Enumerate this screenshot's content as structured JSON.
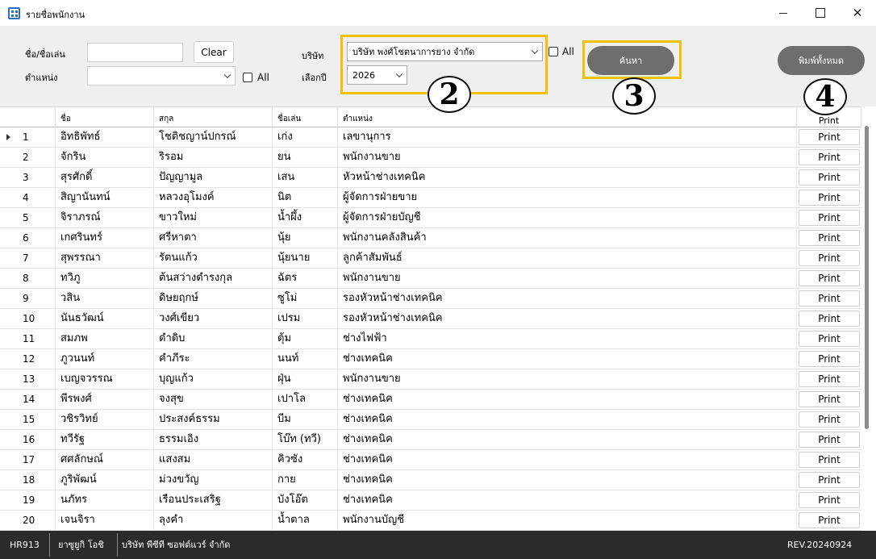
{
  "window": {
    "title": "รายชื่อพนักงาน"
  },
  "filters": {
    "name_label": "ชื่อ/ชื่อเล่น",
    "name_value": "",
    "clear_label": "Clear",
    "position_label": "ตำแหน่ง",
    "position_value": "",
    "position_all_label": "All",
    "company_label": "บริษัท",
    "company_value": "บริษัท พงศ์โชตนาการยาง จำกัด",
    "company_all_label": "All",
    "year_label": "เลือกปี",
    "year_value": "2026",
    "search_label": "ค้นหา",
    "print_all_label": "พิมพ์ทั้งหมด"
  },
  "annotations": [
    "2",
    "3",
    "4"
  ],
  "highlight_color": "#f2c200",
  "table": {
    "headers": [
      "ชื่อ",
      "สกุล",
      "ชื่อเล่น",
      "ตำแหน่ง",
      "Print"
    ],
    "print_label": "Print",
    "rows": [
      {
        "no": "1",
        "first": "อิทธิพัทธ์",
        "last": "โชติชญาน์ปกรณ์",
        "nick": "เก่ง",
        "pos": "เลขานุการ"
      },
      {
        "no": "2",
        "first": "จักริน",
        "last": "ริรอม",
        "nick": "ยน",
        "pos": "พนักงานขาย"
      },
      {
        "no": "3",
        "first": "สุรศักดิ์",
        "last": "ปัญญามูล",
        "nick": "เสน",
        "pos": "หัวหน้าช่างเทคนิค"
      },
      {
        "no": "4",
        "first": "สิญานันทน์",
        "last": "หลวงอุโมงค์",
        "nick": "นิต",
        "pos": "ผู้จัดการฝ่ายขาย"
      },
      {
        "no": "5",
        "first": "จิราภรณ์",
        "last": "ขาวใหม่",
        "nick": "น้ำผึ้ง",
        "pos": "ผู้จัดการฝ่ายบัญชี"
      },
      {
        "no": "6",
        "first": "เกศรินทร์",
        "last": "ศรีหาตา",
        "nick": "นุ้ย",
        "pos": "พนักงานคลังสินค้า"
      },
      {
        "no": "7",
        "first": "สุพรรณา",
        "last": "รัตนแก้ว",
        "nick": "นุ้ยนาย",
        "pos": "ลูกค้าสัมพันธ์"
      },
      {
        "no": "8",
        "first": "ทวิภู",
        "last": "ต้นสว่างดำรงกุล",
        "nick": "ฉัตร",
        "pos": "พนักงานขาย"
      },
      {
        "no": "9",
        "first": "วสิน",
        "last": "ดิษยฤกษ์",
        "nick": "ซูโม่",
        "pos": "รองหัวหน้าช่างเทคนิค"
      },
      {
        "no": "10",
        "first": "นันธวัฒน์",
        "last": "วงศ์เขียว",
        "nick": "เปรม",
        "pos": "รองหัวหน้าช่างเทคนิค"
      },
      {
        "no": "11",
        "first": "สมภพ",
        "last": "ดำดิบ",
        "nick": "ตุ้ม",
        "pos": "ช่างไฟฟ้า"
      },
      {
        "no": "12",
        "first": "ภูวนนท์",
        "last": "คำภีระ",
        "nick": "นนท์",
        "pos": "ช่างเทคนิค"
      },
      {
        "no": "13",
        "first": "เบญจวรรณ",
        "last": "บุญแก้ว",
        "nick": "ฝุ่น",
        "pos": "พนักงานขาย"
      },
      {
        "no": "14",
        "first": "พีรพงศ์",
        "last": "จงสุข",
        "nick": "เปาโล",
        "pos": "ช่างเทคนิค"
      },
      {
        "no": "15",
        "first": "วชิรวิทย์",
        "last": "ประสงค์ธรรม",
        "nick": "บีม",
        "pos": "ช่างเทคนิค"
      },
      {
        "no": "16",
        "first": "ทวีรัฐ",
        "last": "ธรรมเอิง",
        "nick": "โบ๊ท (ทวี)",
        "pos": "ช่างเทคนิค"
      },
      {
        "no": "17",
        "first": "ศศลักษณ์",
        "last": "แสงสม",
        "nick": "คิวซัง",
        "pos": "ช่างเทคนิค"
      },
      {
        "no": "18",
        "first": "ภูริพัฒน์",
        "last": "ม่วงขวัญ",
        "nick": "กาย",
        "pos": "ช่างเทคนิค"
      },
      {
        "no": "19",
        "first": "นภัทร",
        "last": "เรือนประเสริฐ",
        "nick": "บังโอ๊ต",
        "pos": "ช่างเทคนิค"
      },
      {
        "no": "20",
        "first": "เจนจิรา",
        "last": "ลุงคำ",
        "nick": "น้ำตาล",
        "pos": "พนักงานบัญชี"
      }
    ]
  },
  "status": {
    "code": "HR913",
    "user": "ยาซูยูกิ โอชิ",
    "company": "บริษัท พีซีที ซอฟต์แวร์ จำกัด",
    "rev": "REV.20240924"
  }
}
